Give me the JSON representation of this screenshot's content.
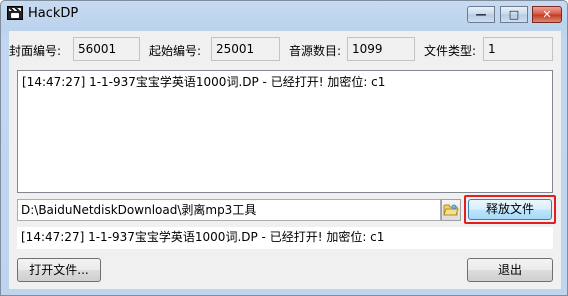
{
  "window": {
    "title": "HackDP",
    "min_glyph": "—",
    "max_glyph": "□",
    "close_glyph": "✕"
  },
  "fields": [
    {
      "label": "封面编号:",
      "value": "56001"
    },
    {
      "label": "起始编号:",
      "value": "25001"
    },
    {
      "label": "音源数目:",
      "value": "1099"
    },
    {
      "label": "文件类型:",
      "value": "1"
    }
  ],
  "log": {
    "lines": [
      "[14:47:27] 1-1-937宝宝学英语1000词.DP - 已经打开! 加密位: c1"
    ]
  },
  "path": {
    "value": "D:\\BaiduNetdiskDownload\\剥离mp3工具"
  },
  "buttons": {
    "release": "释放文件",
    "open": "打开文件...",
    "exit": "退出"
  },
  "status": {
    "text": "[14:47:27] 1-1-937宝宝学英语1000词.DP - 已经打开! 加密位: c1"
  },
  "icons": {
    "app": "app-icon",
    "browse": "folder-icon"
  },
  "colors": {
    "highlight": "#e02020",
    "titlebar": "#c2d7ef"
  }
}
